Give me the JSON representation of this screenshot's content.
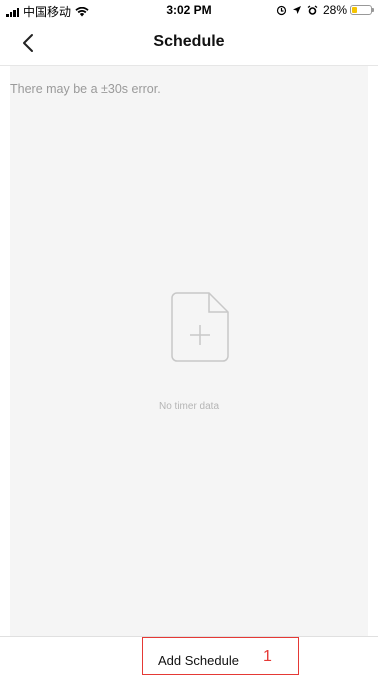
{
  "status_bar": {
    "carrier": "中国移动",
    "time": "3:02 PM",
    "battery_text": "28%",
    "battery_level": 0.28,
    "battery_color": "#f5c400"
  },
  "nav": {
    "title": "Schedule",
    "back_icon": "chevron-left-icon"
  },
  "content": {
    "hint": "There may be a ±30s error.",
    "empty_icon": "file-add-icon",
    "empty_text": "No timer data"
  },
  "bottom": {
    "add_label": "Add Schedule",
    "marker": "1",
    "marker_color": "#e53935"
  }
}
